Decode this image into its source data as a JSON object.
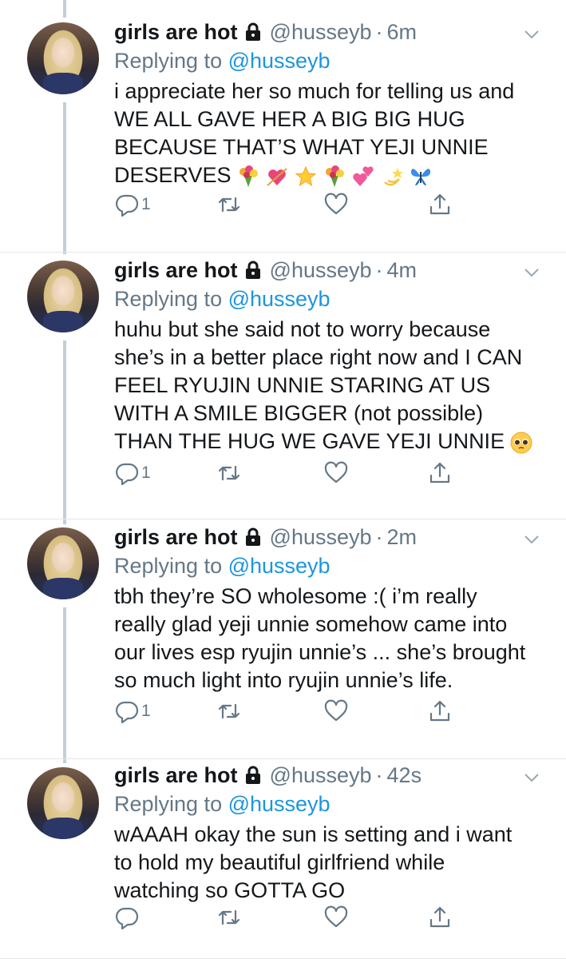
{
  "tweets": [
    {
      "name": "girls are hot",
      "handle": "@husseyb",
      "dot": "·",
      "time": "6m",
      "replying_prefix": "Replying to ",
      "replying_to": "@husseyb",
      "lines": [
        "i appreciate her so much for telling us and",
        "WE ALL GAVE HER A BIG BIG HUG",
        "BECAUSE THAT’S WHAT YEJI UNNIE",
        "DESERVES"
      ],
      "emojis": [
        "bouquet-emoji",
        "heart-arrow-emoji",
        "glowing-star-emoji",
        "bouquet-emoji",
        "two-hearts-emoji",
        "dizzy-emoji",
        "butterfly-emoji"
      ],
      "reply_count": "1"
    },
    {
      "name": "girls are hot",
      "handle": "@husseyb",
      "dot": "·",
      "time": "4m",
      "replying_prefix": "Replying to ",
      "replying_to": "@husseyb",
      "lines": [
        "huhu but she said not to worry because",
        "she’s in a better place right now and I CAN",
        "FEEL RYUJIN UNNIE STARING AT US",
        "WITH A SMILE BIGGER (not possible)",
        "THAN THE HUG WE GAVE YEJI UNNIE"
      ],
      "emojis": [
        "pleading-face-emoji"
      ],
      "reply_count": "1"
    },
    {
      "name": "girls are hot",
      "handle": "@husseyb",
      "dot": "·",
      "time": "2m",
      "replying_prefix": "Replying to ",
      "replying_to": "@husseyb",
      "lines": [
        "tbh they’re SO wholesome :( i’m really",
        "really glad yeji unnie somehow came into",
        "our lives esp ryujin unnie’s ... she’s brought",
        "so much light into ryujin unnie’s life."
      ],
      "emojis": [],
      "reply_count": "1"
    },
    {
      "name": "girls are hot",
      "handle": "@husseyb",
      "dot": "·",
      "time": "42s",
      "replying_prefix": "Replying to ",
      "replying_to": "@husseyb",
      "lines": [
        "wAAAH okay the sun is setting and i want",
        "to hold my beautiful girlfriend while",
        "watching so GOTTA GO"
      ],
      "emojis": [],
      "reply_count": ""
    }
  ],
  "colors": {
    "text": "#14171a",
    "muted": "#657786",
    "link": "#1b95e0",
    "thread_line": "#c4cfd6",
    "divider": "#e1e8ed"
  },
  "icons": {
    "lock": "lock-icon",
    "chevron": "chevron-down-icon",
    "reply": "reply-icon",
    "retweet": "retweet-icon",
    "like": "like-icon",
    "share": "share-icon"
  }
}
